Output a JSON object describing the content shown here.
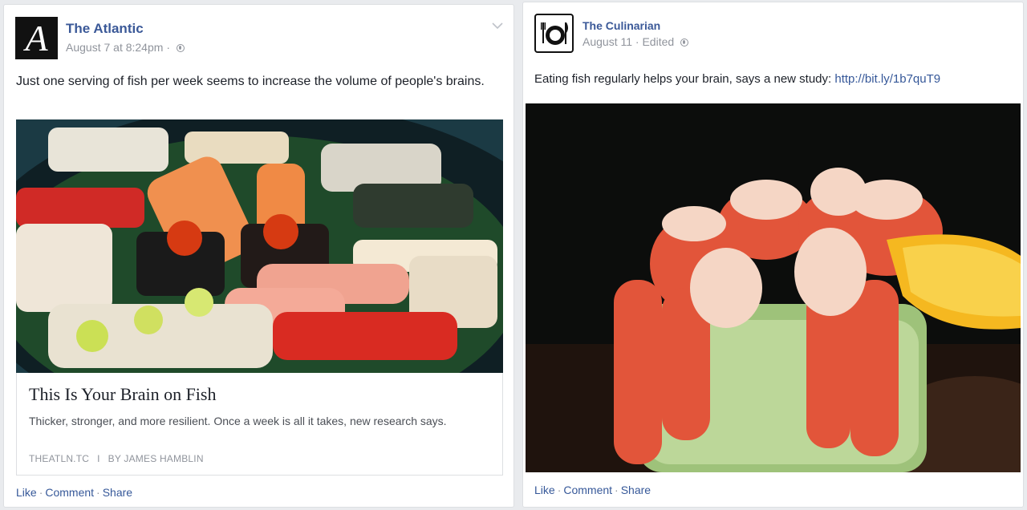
{
  "posts": [
    {
      "page_name": "The Atlantic",
      "avatar_letter": "A",
      "date": "August 7 at 8:24pm",
      "meta_separator": "·",
      "text": "Just one serving of fish per week seems to increase the volume of people's brains.",
      "link": {
        "title": "This Is Your Brain on Fish",
        "description": "Thicker, stronger, and more resilient. Once a week is all it takes, new research says.",
        "domain": "THEATLN.TC",
        "separator": "I",
        "byline": "BY JAMES HAMBLIN"
      },
      "actions": [
        "Like",
        "Comment",
        "Share"
      ]
    },
    {
      "page_name": "The Culinarian",
      "date": "August 11",
      "meta_separator": "·",
      "edited": "Edited",
      "text": "Eating fish regularly helps your brain, says a new study:",
      "url": "http://bit.ly/1b7quT9",
      "actions": [
        "Like",
        "Comment",
        "Share"
      ]
    }
  ],
  "action_separator": "·",
  "colors": {
    "link_blue": "#3b5998",
    "meta_gray": "#90949c",
    "background": "#e9ebee"
  },
  "icons": {
    "privacy": "globe-icon",
    "menu": "chevron-down-icon"
  }
}
